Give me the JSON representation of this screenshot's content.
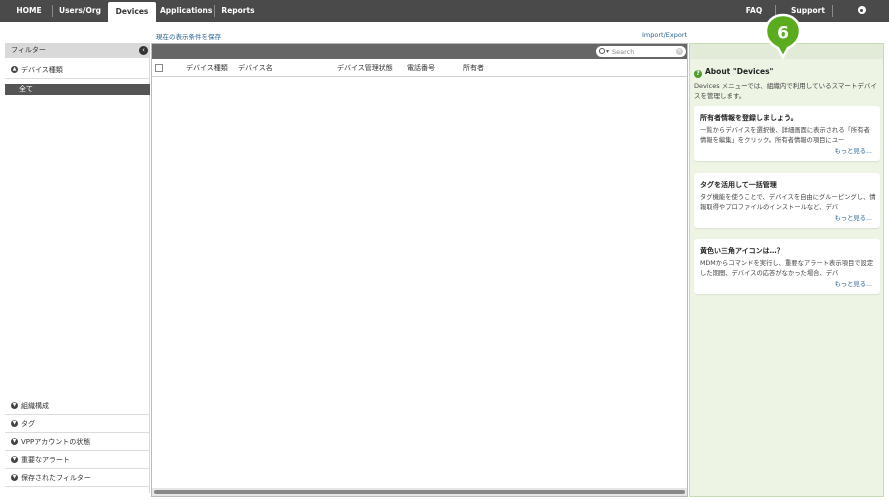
{
  "nav": {
    "tabs": [
      {
        "label": "HOME"
      },
      {
        "label": "Users/Org"
      },
      {
        "label": "Devices"
      },
      {
        "label": "Applications"
      },
      {
        "label": "Reports"
      }
    ],
    "faq": "FAQ",
    "support": "Support",
    "settings": "Settings",
    "active_tab": "Devices",
    "bar_color": "#4a4a4a"
  },
  "links": {
    "save_filter": "現在の表示条件を保存",
    "import_export": "Import/Export"
  },
  "sidebar": {
    "title": "フィルター",
    "device_type": "デバイス種類",
    "all_option": "全て",
    "sections": [
      {
        "label": "組織構成"
      },
      {
        "label": "タグ"
      },
      {
        "label": "VPPアカウントの状態"
      },
      {
        "label": "重要なアラート"
      },
      {
        "label": "保存されたフィルター"
      }
    ]
  },
  "table": {
    "search_placeholder": "Search",
    "columns": [
      {
        "label": "デバイス種類"
      },
      {
        "label": "デバイス名"
      },
      {
        "label": "デバイス管理状態"
      },
      {
        "label": "電話番号"
      },
      {
        "label": "所有者"
      }
    ]
  },
  "info": {
    "title": "About \"Devices\"",
    "description": "Devices メニューでは、組織内で利用しているスマートデバイスを管理します。",
    "cards": [
      {
        "title": "所有者情報を登録しましょう。",
        "body": "一覧からデバイスを選択後、詳細画面に表示される「所有者情報を編集」をクリック。所有者情報の項目にユー",
        "more": "もっと見る..."
      },
      {
        "title": "タグを活用して一括管理",
        "body": "タグ機能を使うことで、デバイスを自由にグルーピングし、情報取得やプロファイルのインストールなど、デバ",
        "more": "もっと見る..."
      },
      {
        "title": "黄色い三角アイコンは…？",
        "body": "MDMからコマンドを実行し、重要なアラート表示項目で設定した期間、デバイスの応答がなかった場合、デバ",
        "more": "もっと見る..."
      }
    ],
    "panel_color": "#eef4e4",
    "accent_color": "#4f9a2e"
  },
  "callout": {
    "number": "6",
    "color": "#5aab1e"
  }
}
